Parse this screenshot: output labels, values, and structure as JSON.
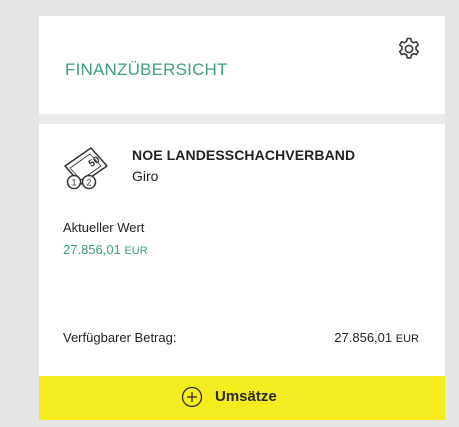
{
  "header": {
    "title": "FINANZÜBERSICHT",
    "settings_icon": "gear-icon"
  },
  "account": {
    "icon": "coins-banknote-icon",
    "icon_banknote_value": "50",
    "icon_coin_1": "1",
    "icon_coin_2": "2",
    "name": "NOE LANDESSCHACHVERBAND",
    "type": "Giro"
  },
  "current_value": {
    "label": "Aktueller Wert",
    "amount": "27.856,01",
    "currency": "EUR"
  },
  "available": {
    "label": "Verfügbarer Betrag:",
    "amount": "27.856,01",
    "currency": "EUR"
  },
  "action": {
    "label": "Umsätze",
    "icon": "plus-circle-icon"
  },
  "colors": {
    "accent_green": "#3f9e84",
    "action_yellow": "#f4ec1e",
    "background": "#e6e6e6"
  }
}
